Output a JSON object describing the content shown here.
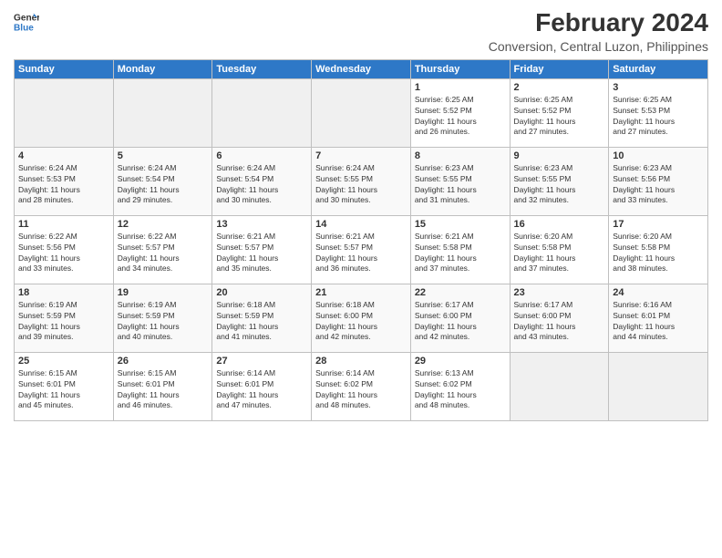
{
  "header": {
    "title": "February 2024",
    "subtitle": "Conversion, Central Luzon, Philippines",
    "logo_line1": "General",
    "logo_line2": "Blue"
  },
  "columns": [
    "Sunday",
    "Monday",
    "Tuesday",
    "Wednesday",
    "Thursday",
    "Friday",
    "Saturday"
  ],
  "weeks": [
    [
      {
        "day": "",
        "info": ""
      },
      {
        "day": "",
        "info": ""
      },
      {
        "day": "",
        "info": ""
      },
      {
        "day": "",
        "info": ""
      },
      {
        "day": "1",
        "info": "Sunrise: 6:25 AM\nSunset: 5:52 PM\nDaylight: 11 hours\nand 26 minutes."
      },
      {
        "day": "2",
        "info": "Sunrise: 6:25 AM\nSunset: 5:52 PM\nDaylight: 11 hours\nand 27 minutes."
      },
      {
        "day": "3",
        "info": "Sunrise: 6:25 AM\nSunset: 5:53 PM\nDaylight: 11 hours\nand 27 minutes."
      }
    ],
    [
      {
        "day": "4",
        "info": "Sunrise: 6:24 AM\nSunset: 5:53 PM\nDaylight: 11 hours\nand 28 minutes."
      },
      {
        "day": "5",
        "info": "Sunrise: 6:24 AM\nSunset: 5:54 PM\nDaylight: 11 hours\nand 29 minutes."
      },
      {
        "day": "6",
        "info": "Sunrise: 6:24 AM\nSunset: 5:54 PM\nDaylight: 11 hours\nand 30 minutes."
      },
      {
        "day": "7",
        "info": "Sunrise: 6:24 AM\nSunset: 5:55 PM\nDaylight: 11 hours\nand 30 minutes."
      },
      {
        "day": "8",
        "info": "Sunrise: 6:23 AM\nSunset: 5:55 PM\nDaylight: 11 hours\nand 31 minutes."
      },
      {
        "day": "9",
        "info": "Sunrise: 6:23 AM\nSunset: 5:55 PM\nDaylight: 11 hours\nand 32 minutes."
      },
      {
        "day": "10",
        "info": "Sunrise: 6:23 AM\nSunset: 5:56 PM\nDaylight: 11 hours\nand 33 minutes."
      }
    ],
    [
      {
        "day": "11",
        "info": "Sunrise: 6:22 AM\nSunset: 5:56 PM\nDaylight: 11 hours\nand 33 minutes."
      },
      {
        "day": "12",
        "info": "Sunrise: 6:22 AM\nSunset: 5:57 PM\nDaylight: 11 hours\nand 34 minutes."
      },
      {
        "day": "13",
        "info": "Sunrise: 6:21 AM\nSunset: 5:57 PM\nDaylight: 11 hours\nand 35 minutes."
      },
      {
        "day": "14",
        "info": "Sunrise: 6:21 AM\nSunset: 5:57 PM\nDaylight: 11 hours\nand 36 minutes."
      },
      {
        "day": "15",
        "info": "Sunrise: 6:21 AM\nSunset: 5:58 PM\nDaylight: 11 hours\nand 37 minutes."
      },
      {
        "day": "16",
        "info": "Sunrise: 6:20 AM\nSunset: 5:58 PM\nDaylight: 11 hours\nand 37 minutes."
      },
      {
        "day": "17",
        "info": "Sunrise: 6:20 AM\nSunset: 5:58 PM\nDaylight: 11 hours\nand 38 minutes."
      }
    ],
    [
      {
        "day": "18",
        "info": "Sunrise: 6:19 AM\nSunset: 5:59 PM\nDaylight: 11 hours\nand 39 minutes."
      },
      {
        "day": "19",
        "info": "Sunrise: 6:19 AM\nSunset: 5:59 PM\nDaylight: 11 hours\nand 40 minutes."
      },
      {
        "day": "20",
        "info": "Sunrise: 6:18 AM\nSunset: 5:59 PM\nDaylight: 11 hours\nand 41 minutes."
      },
      {
        "day": "21",
        "info": "Sunrise: 6:18 AM\nSunset: 6:00 PM\nDaylight: 11 hours\nand 42 minutes."
      },
      {
        "day": "22",
        "info": "Sunrise: 6:17 AM\nSunset: 6:00 PM\nDaylight: 11 hours\nand 42 minutes."
      },
      {
        "day": "23",
        "info": "Sunrise: 6:17 AM\nSunset: 6:00 PM\nDaylight: 11 hours\nand 43 minutes."
      },
      {
        "day": "24",
        "info": "Sunrise: 6:16 AM\nSunset: 6:01 PM\nDaylight: 11 hours\nand 44 minutes."
      }
    ],
    [
      {
        "day": "25",
        "info": "Sunrise: 6:15 AM\nSunset: 6:01 PM\nDaylight: 11 hours\nand 45 minutes."
      },
      {
        "day": "26",
        "info": "Sunrise: 6:15 AM\nSunset: 6:01 PM\nDaylight: 11 hours\nand 46 minutes."
      },
      {
        "day": "27",
        "info": "Sunrise: 6:14 AM\nSunset: 6:01 PM\nDaylight: 11 hours\nand 47 minutes."
      },
      {
        "day": "28",
        "info": "Sunrise: 6:14 AM\nSunset: 6:02 PM\nDaylight: 11 hours\nand 48 minutes."
      },
      {
        "day": "29",
        "info": "Sunrise: 6:13 AM\nSunset: 6:02 PM\nDaylight: 11 hours\nand 48 minutes."
      },
      {
        "day": "",
        "info": ""
      },
      {
        "day": "",
        "info": ""
      }
    ]
  ]
}
